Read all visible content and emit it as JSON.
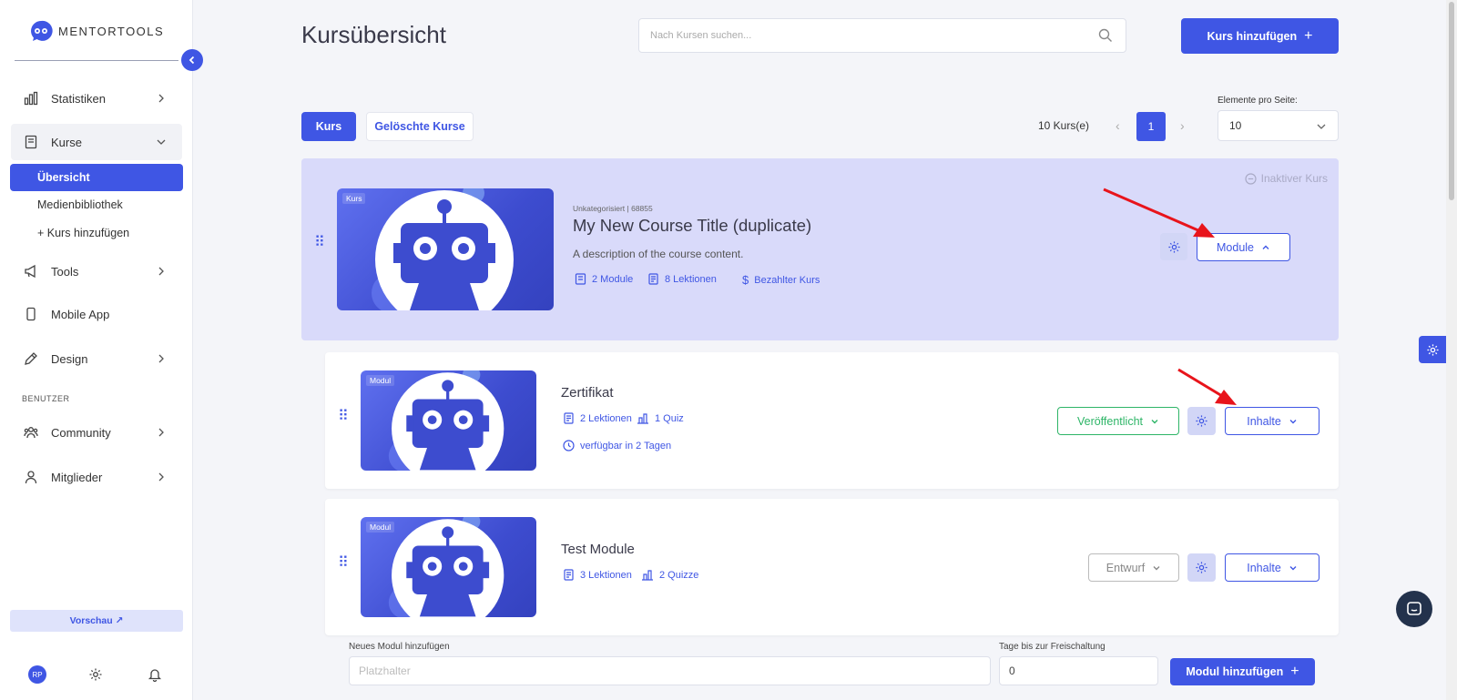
{
  "app": {
    "logo_text": "MENTORTOOLS"
  },
  "sidebar": {
    "items": [
      {
        "label": "Statistiken",
        "icon": "bar-chart-icon"
      },
      {
        "label": "Kurse",
        "icon": "book-icon"
      },
      {
        "label": "Tools",
        "icon": "megaphone-icon"
      },
      {
        "label": "Mobile App",
        "icon": "phone-icon"
      },
      {
        "label": "Design",
        "icon": "pen-icon"
      },
      {
        "label": "Community",
        "icon": "people-icon"
      },
      {
        "label": "Mitglieder",
        "icon": "user-icon"
      }
    ],
    "kurse_sub": [
      "Übersicht",
      "Medienbibliothek",
      "+ Kurs hinzufügen"
    ],
    "section_label": "BENUTZER",
    "preview_label": "Vorschau ↗",
    "avatar_initials": "RP"
  },
  "header": {
    "title": "Kursübersicht",
    "search_placeholder": "Nach Kursen suchen...",
    "add_course_label": "Kurs hinzufügen"
  },
  "tabs": [
    "Kurs",
    "Gelöschte Kurse"
  ],
  "pagination": {
    "count_label": "10 Kurs(e)",
    "current_page": "1",
    "per_page_label": "Elemente pro Seite:",
    "per_page_value": "10"
  },
  "course": {
    "tag": "Kurs",
    "inactive_label": "Inaktiver Kurs",
    "meta": "Unkategorisiert | 68855",
    "title": "My New Course Title (duplicate)",
    "description": "A description of the course content.",
    "modules": "2 Module",
    "lessons": "8 Lektionen",
    "paid": "Bezahlter Kurs",
    "module_button": "Module"
  },
  "modules": [
    {
      "tag": "Modul",
      "title": "Zertifikat",
      "lessons": "2 Lektionen",
      "quiz": "1 Quiz",
      "availability": "verfügbar in 2 Tagen",
      "status": "Veröffentlicht",
      "content_button": "Inhalte"
    },
    {
      "tag": "Modul",
      "title": "Test Module",
      "lessons": "3 Lektionen",
      "quiz": "2 Quizze",
      "status": "Entwurf",
      "content_button": "Inhalte"
    }
  ],
  "new_module": {
    "label": "Neues Modul hinzufügen",
    "placeholder": "Platzhalter",
    "days_label": "Tage bis zur Freischaltung",
    "days_value": "0",
    "button": "Modul hinzufügen"
  },
  "colors": {
    "accent": "#3f56e4",
    "published": "#2eb567",
    "annotation_arrow": "#e8141b"
  }
}
